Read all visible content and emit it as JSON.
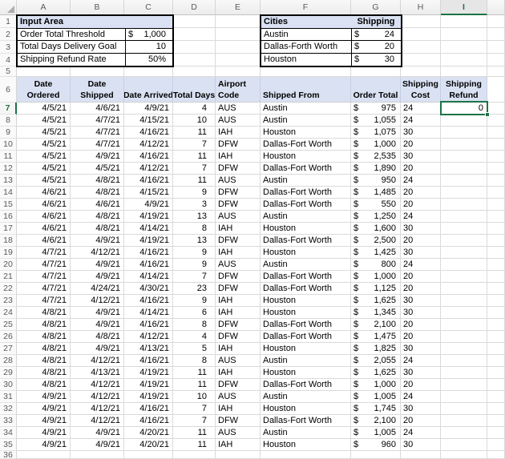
{
  "sheet": {
    "column_headers": [
      "A",
      "B",
      "C",
      "D",
      "E",
      "F",
      "G",
      "H",
      "I"
    ],
    "row_count": 36,
    "selected_column": "I",
    "selected_row": "7",
    "selected_cell": "I7",
    "selected_cell_value": "0"
  },
  "colors": {
    "table_header_fill": "#D9E1F2",
    "selection_green": "#1B7346",
    "gridline": "#DADADA",
    "table_border": "#000000"
  },
  "input_area": {
    "title": "Input Area",
    "rows": [
      {
        "label": "Order Total Threshold",
        "currency": "$",
        "value": "1,000"
      },
      {
        "label": "Total Days Delivery Goal",
        "currency": "",
        "value": "10"
      },
      {
        "label": "Shipping Refund Rate",
        "currency": "",
        "value": "50%"
      }
    ]
  },
  "cities": {
    "title": "Cities",
    "shipping_label": "Shipping",
    "rows": [
      {
        "city": "Austin",
        "currency": "$",
        "cost": "24"
      },
      {
        "city": "Dallas-Forth Worth",
        "currency": "$",
        "cost": "20"
      },
      {
        "city": "Houston",
        "currency": "$",
        "cost": "30"
      }
    ]
  },
  "orders": {
    "currency_symbol": "$",
    "headers": [
      [
        "Date",
        "Ordered"
      ],
      [
        "Date",
        "Shipped"
      ],
      [
        "Date Arrived"
      ],
      [
        "Total Days"
      ],
      [
        "Airport",
        "Code"
      ],
      [
        "Shipped From"
      ],
      [
        "Order Total"
      ],
      [
        "Shipping",
        "Cost"
      ],
      [
        "Shipping",
        "Refund"
      ]
    ],
    "rows": [
      [
        "4/5/21",
        "4/6/21",
        "4/9/21",
        "4",
        "AUS",
        "Austin",
        "975",
        "24",
        "0"
      ],
      [
        "4/5/21",
        "4/7/21",
        "4/15/21",
        "10",
        "AUS",
        "Austin",
        "1,055",
        "24",
        ""
      ],
      [
        "4/5/21",
        "4/7/21",
        "4/16/21",
        "11",
        "IAH",
        "Houston",
        "1,075",
        "30",
        ""
      ],
      [
        "4/5/21",
        "4/7/21",
        "4/12/21",
        "7",
        "DFW",
        "Dallas-Fort Worth",
        "1,000",
        "20",
        ""
      ],
      [
        "4/5/21",
        "4/9/21",
        "4/16/21",
        "11",
        "IAH",
        "Houston",
        "2,535",
        "30",
        ""
      ],
      [
        "4/5/21",
        "4/5/21",
        "4/12/21",
        "7",
        "DFW",
        "Dallas-Fort Worth",
        "1,890",
        "20",
        ""
      ],
      [
        "4/5/21",
        "4/8/21",
        "4/16/21",
        "11",
        "AUS",
        "Austin",
        "950",
        "24",
        ""
      ],
      [
        "4/6/21",
        "4/8/21",
        "4/15/21",
        "9",
        "DFW",
        "Dallas-Fort Worth",
        "1,485",
        "20",
        ""
      ],
      [
        "4/6/21",
        "4/6/21",
        "4/9/21",
        "3",
        "DFW",
        "Dallas-Fort Worth",
        "550",
        "20",
        ""
      ],
      [
        "4/6/21",
        "4/8/21",
        "4/19/21",
        "13",
        "AUS",
        "Austin",
        "1,250",
        "24",
        ""
      ],
      [
        "4/6/21",
        "4/8/21",
        "4/14/21",
        "8",
        "IAH",
        "Houston",
        "1,600",
        "30",
        ""
      ],
      [
        "4/6/21",
        "4/9/21",
        "4/19/21",
        "13",
        "DFW",
        "Dallas-Fort Worth",
        "2,500",
        "20",
        ""
      ],
      [
        "4/7/21",
        "4/12/21",
        "4/16/21",
        "9",
        "IAH",
        "Houston",
        "1,425",
        "30",
        ""
      ],
      [
        "4/7/21",
        "4/9/21",
        "4/16/21",
        "9",
        "AUS",
        "Austin",
        "800",
        "24",
        ""
      ],
      [
        "4/7/21",
        "4/9/21",
        "4/14/21",
        "7",
        "DFW",
        "Dallas-Fort Worth",
        "1,000",
        "20",
        ""
      ],
      [
        "4/7/21",
        "4/24/21",
        "4/30/21",
        "23",
        "DFW",
        "Dallas-Fort Worth",
        "1,125",
        "20",
        ""
      ],
      [
        "4/7/21",
        "4/12/21",
        "4/16/21",
        "9",
        "IAH",
        "Houston",
        "1,625",
        "30",
        ""
      ],
      [
        "4/8/21",
        "4/9/21",
        "4/14/21",
        "6",
        "IAH",
        "Houston",
        "1,345",
        "30",
        ""
      ],
      [
        "4/8/21",
        "4/9/21",
        "4/16/21",
        "8",
        "DFW",
        "Dallas-Fort Worth",
        "2,100",
        "20",
        ""
      ],
      [
        "4/8/21",
        "4/8/21",
        "4/12/21",
        "4",
        "DFW",
        "Dallas-Fort Worth",
        "1,475",
        "20",
        ""
      ],
      [
        "4/8/21",
        "4/9/21",
        "4/13/21",
        "5",
        "IAH",
        "Houston",
        "1,825",
        "30",
        ""
      ],
      [
        "4/8/21",
        "4/12/21",
        "4/16/21",
        "8",
        "AUS",
        "Austin",
        "2,055",
        "24",
        ""
      ],
      [
        "4/8/21",
        "4/13/21",
        "4/19/21",
        "11",
        "IAH",
        "Houston",
        "1,625",
        "30",
        ""
      ],
      [
        "4/8/21",
        "4/12/21",
        "4/19/21",
        "11",
        "DFW",
        "Dallas-Fort Worth",
        "1,000",
        "20",
        ""
      ],
      [
        "4/9/21",
        "4/12/21",
        "4/19/21",
        "10",
        "AUS",
        "Austin",
        "1,005",
        "24",
        ""
      ],
      [
        "4/9/21",
        "4/12/21",
        "4/16/21",
        "7",
        "IAH",
        "Houston",
        "1,745",
        "30",
        ""
      ],
      [
        "4/9/21",
        "4/12/21",
        "4/16/21",
        "7",
        "DFW",
        "Dallas-Fort Worth",
        "2,100",
        "20",
        ""
      ],
      [
        "4/9/21",
        "4/9/21",
        "4/20/21",
        "11",
        "AUS",
        "Austin",
        "1,005",
        "24",
        ""
      ],
      [
        "4/9/21",
        "4/9/21",
        "4/20/21",
        "11",
        "IAH",
        "Houston",
        "960",
        "30",
        ""
      ]
    ]
  }
}
